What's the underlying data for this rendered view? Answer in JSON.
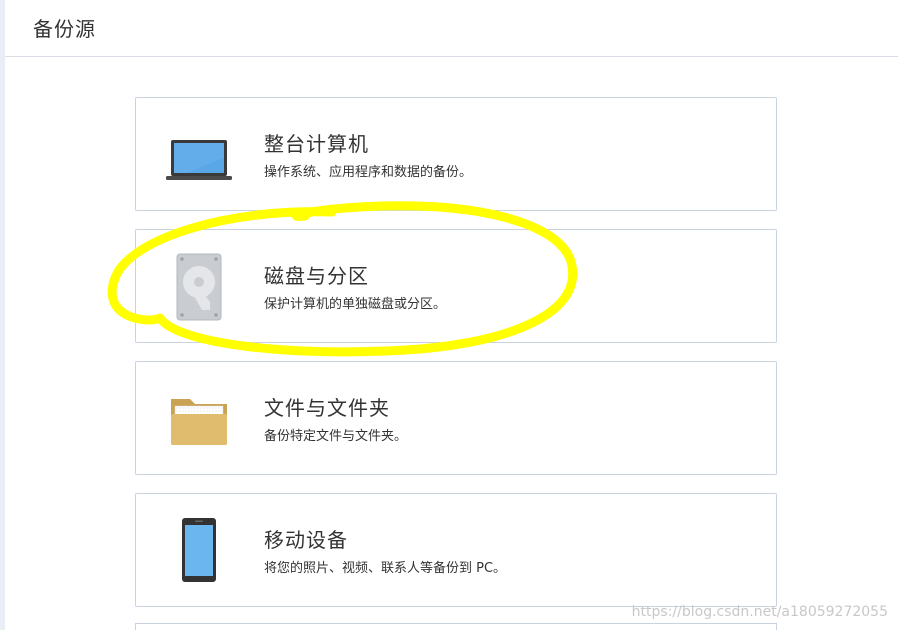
{
  "header": {
    "title": "备份源"
  },
  "options": [
    {
      "title": "整台计算机",
      "description": "操作系统、应用程序和数据的备份。",
      "icon": "laptop-icon"
    },
    {
      "title": "磁盘与分区",
      "description": "保护计算机的单独磁盘或分区。",
      "icon": "hard-disk-icon"
    },
    {
      "title": "文件与文件夹",
      "description": "备份特定文件与文件夹。",
      "icon": "folder-icon"
    },
    {
      "title": "移动设备",
      "description": "将您的照片、视频、联系人等备份到 PC。",
      "icon": "mobile-phone-icon"
    }
  ],
  "annotation": {
    "color": "#ffff00",
    "shape": "hand-drawn-ellipse"
  },
  "watermark": {
    "text": "https://blog.csdn.net/a18059272055"
  },
  "colors": {
    "card_border": "#c9d3e0",
    "laptop_screen": "#5aa7e8",
    "folder": "#e0bd6e",
    "phone_screen": "#6cb6f0"
  }
}
